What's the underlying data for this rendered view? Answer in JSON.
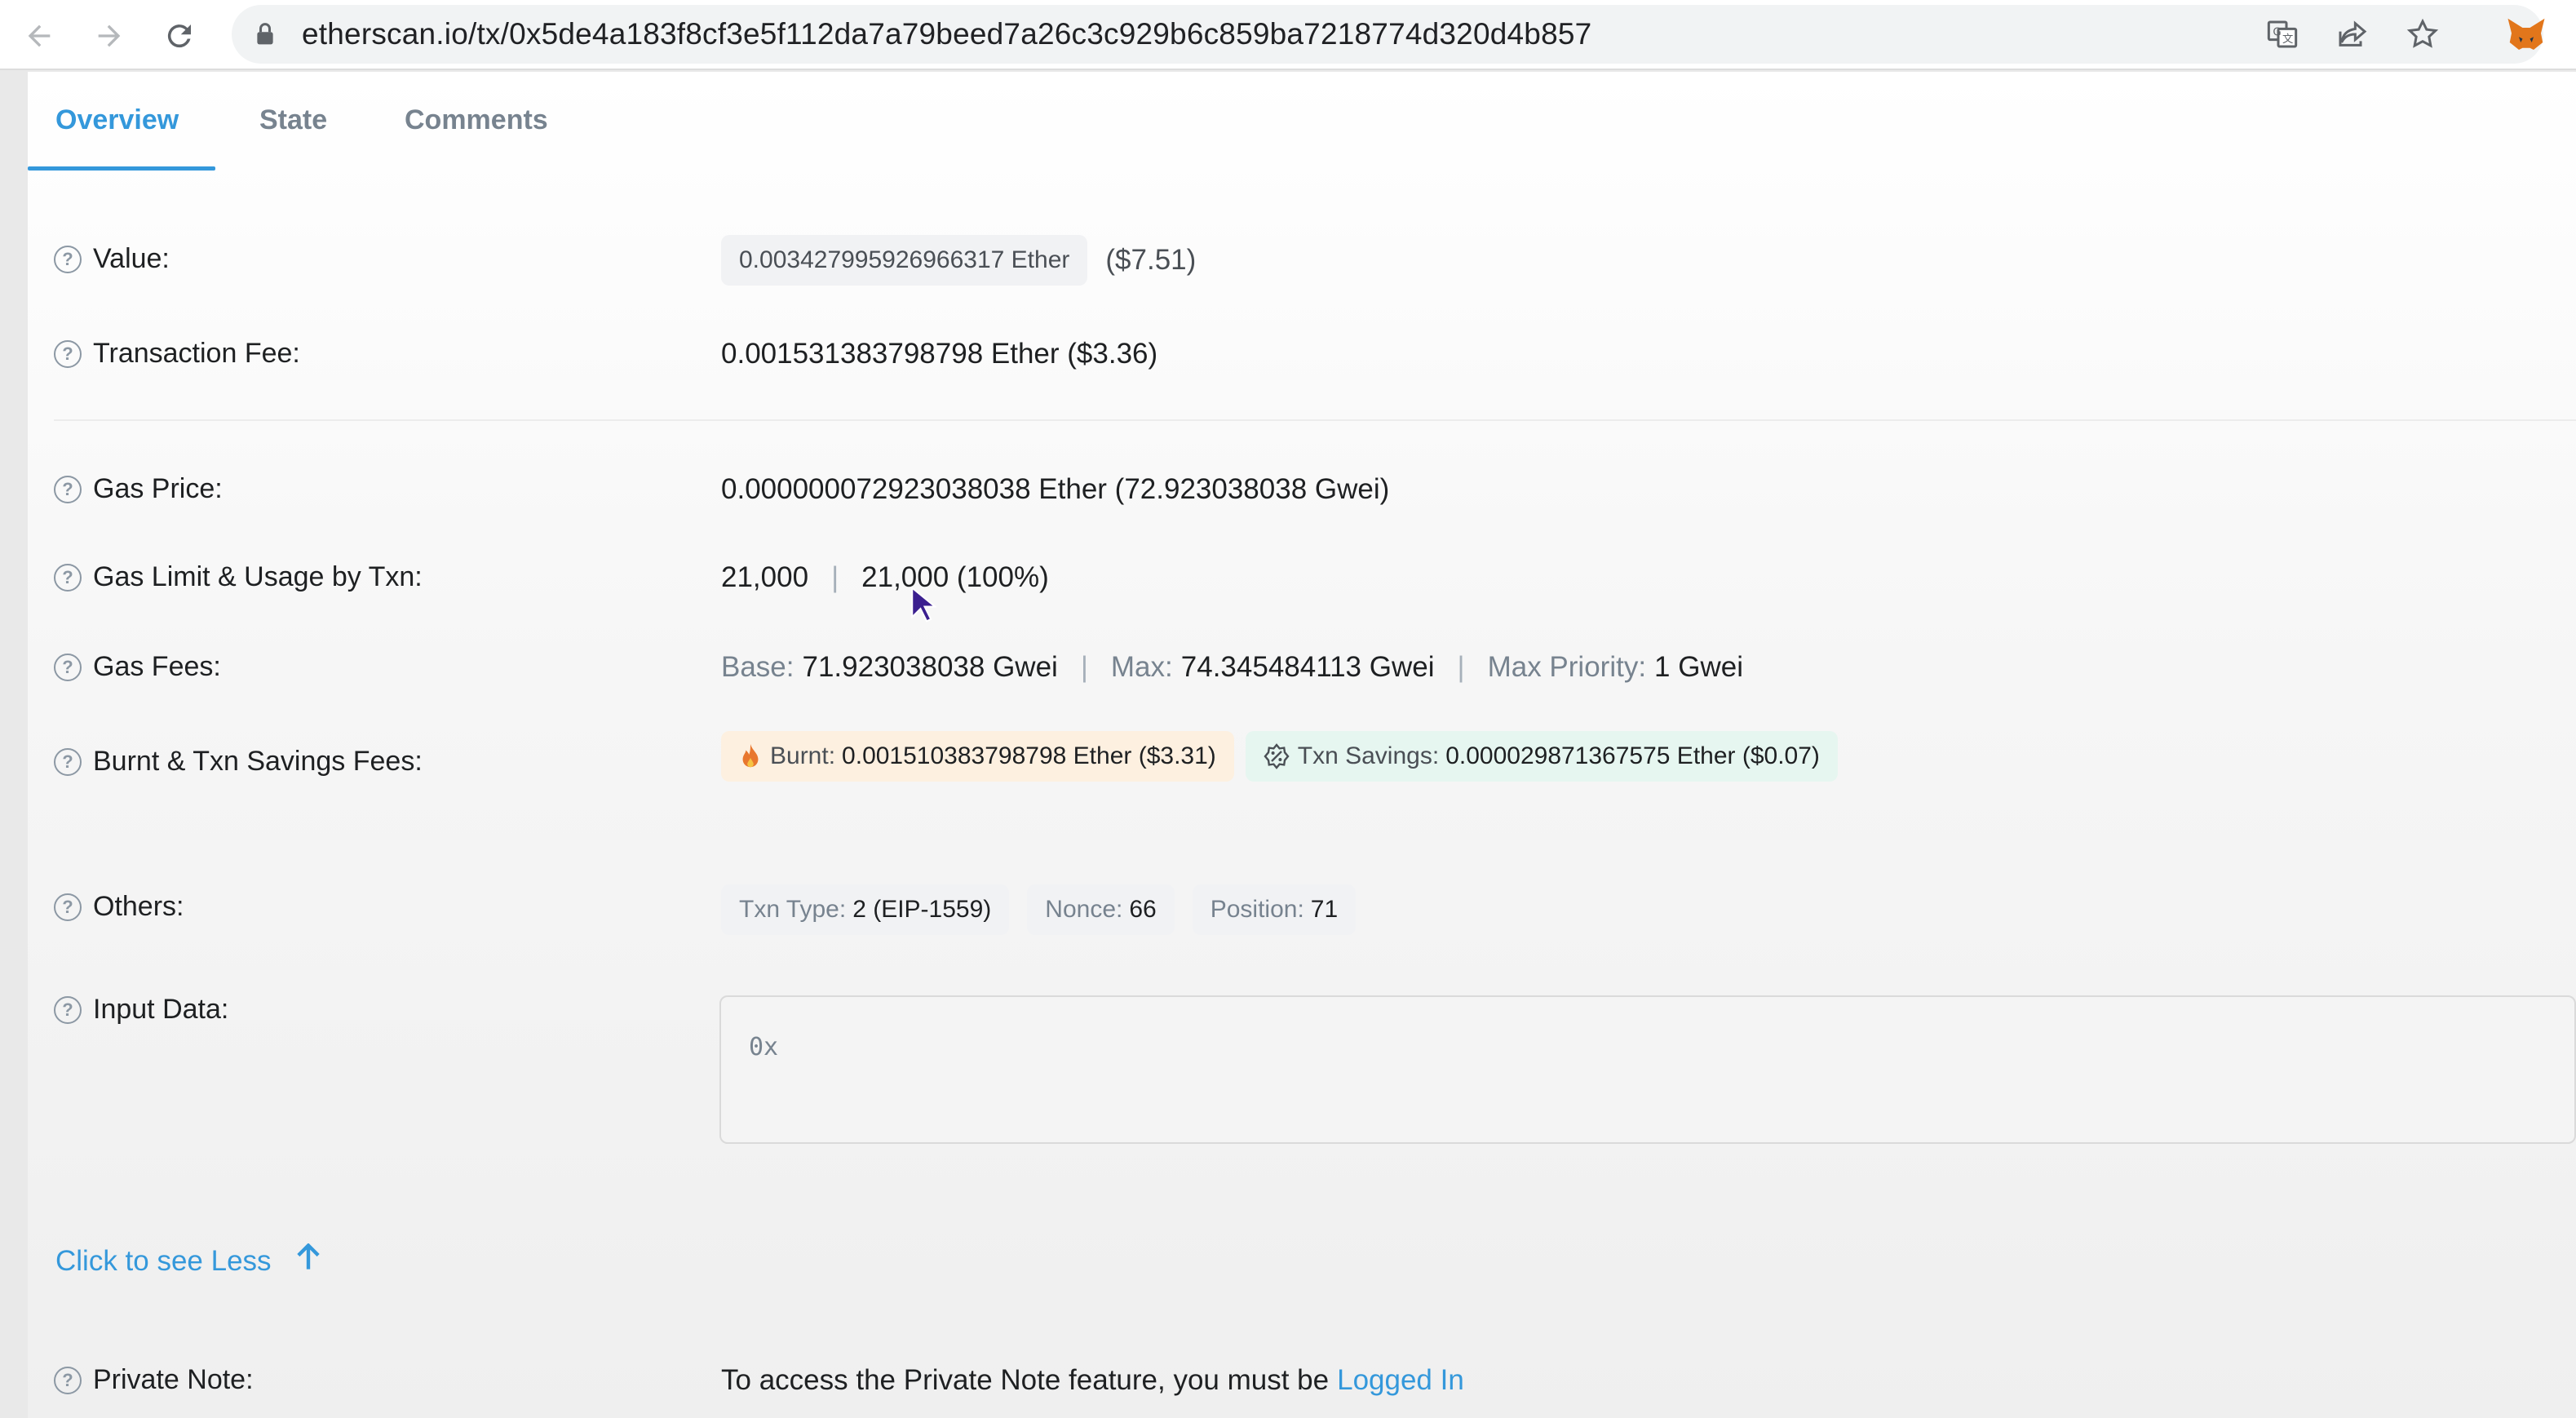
{
  "browser": {
    "url": "etherscan.io/tx/0x5de4a183f8cf3e5f112da7a79beed7a26c3c929b6c859ba7218774d320d4b857"
  },
  "tabs": [
    {
      "label": "Overview"
    },
    {
      "label": "State"
    },
    {
      "label": "Comments"
    }
  ],
  "rows": {
    "value": {
      "label": "Value:",
      "amount": "0.003427995926966317 Ether",
      "usd": "($7.51)"
    },
    "fee": {
      "label": "Transaction Fee:",
      "text": "0.001531383798798 Ether ($3.36)"
    },
    "gas_price": {
      "label": "Gas Price:",
      "text": "0.000000072923038038 Ether (72.923038038 Gwei)"
    },
    "gas_limit": {
      "label": "Gas Limit & Usage by Txn:",
      "limit": "21,000",
      "usage": "21,000 (100%)"
    },
    "gas_fees": {
      "label": "Gas Fees:",
      "base_label": "Base:",
      "base": "71.923038038 Gwei",
      "max_label": "Max:",
      "max": "74.345484113 Gwei",
      "priority_label": "Max Priority:",
      "priority": "1 Gwei"
    },
    "burnt": {
      "label": "Burnt & Txn Savings Fees:",
      "burnt_label": "Burnt:",
      "burnt_value": "0.001510383798798 Ether ($3.31)",
      "savings_label": "Txn Savings:",
      "savings_value": "0.000029871367575 Ether ($0.07)"
    },
    "others": {
      "label": "Others:",
      "txn_type_label": "Txn Type:",
      "txn_type": "2 (EIP-1559)",
      "nonce_label": "Nonce:",
      "nonce": "66",
      "position_label": "Position:",
      "position": "71"
    },
    "input": {
      "label": "Input Data:",
      "value": "0x"
    },
    "private_note": {
      "label": "Private Note:",
      "text": "To access the Private Note feature, you must be",
      "link": "Logged In"
    }
  },
  "see_less": "Click to see Less",
  "colors": {
    "accent": "#3498db",
    "burnt_bg": "#fdf0e0",
    "savings_bg": "#e6f6f0"
  }
}
